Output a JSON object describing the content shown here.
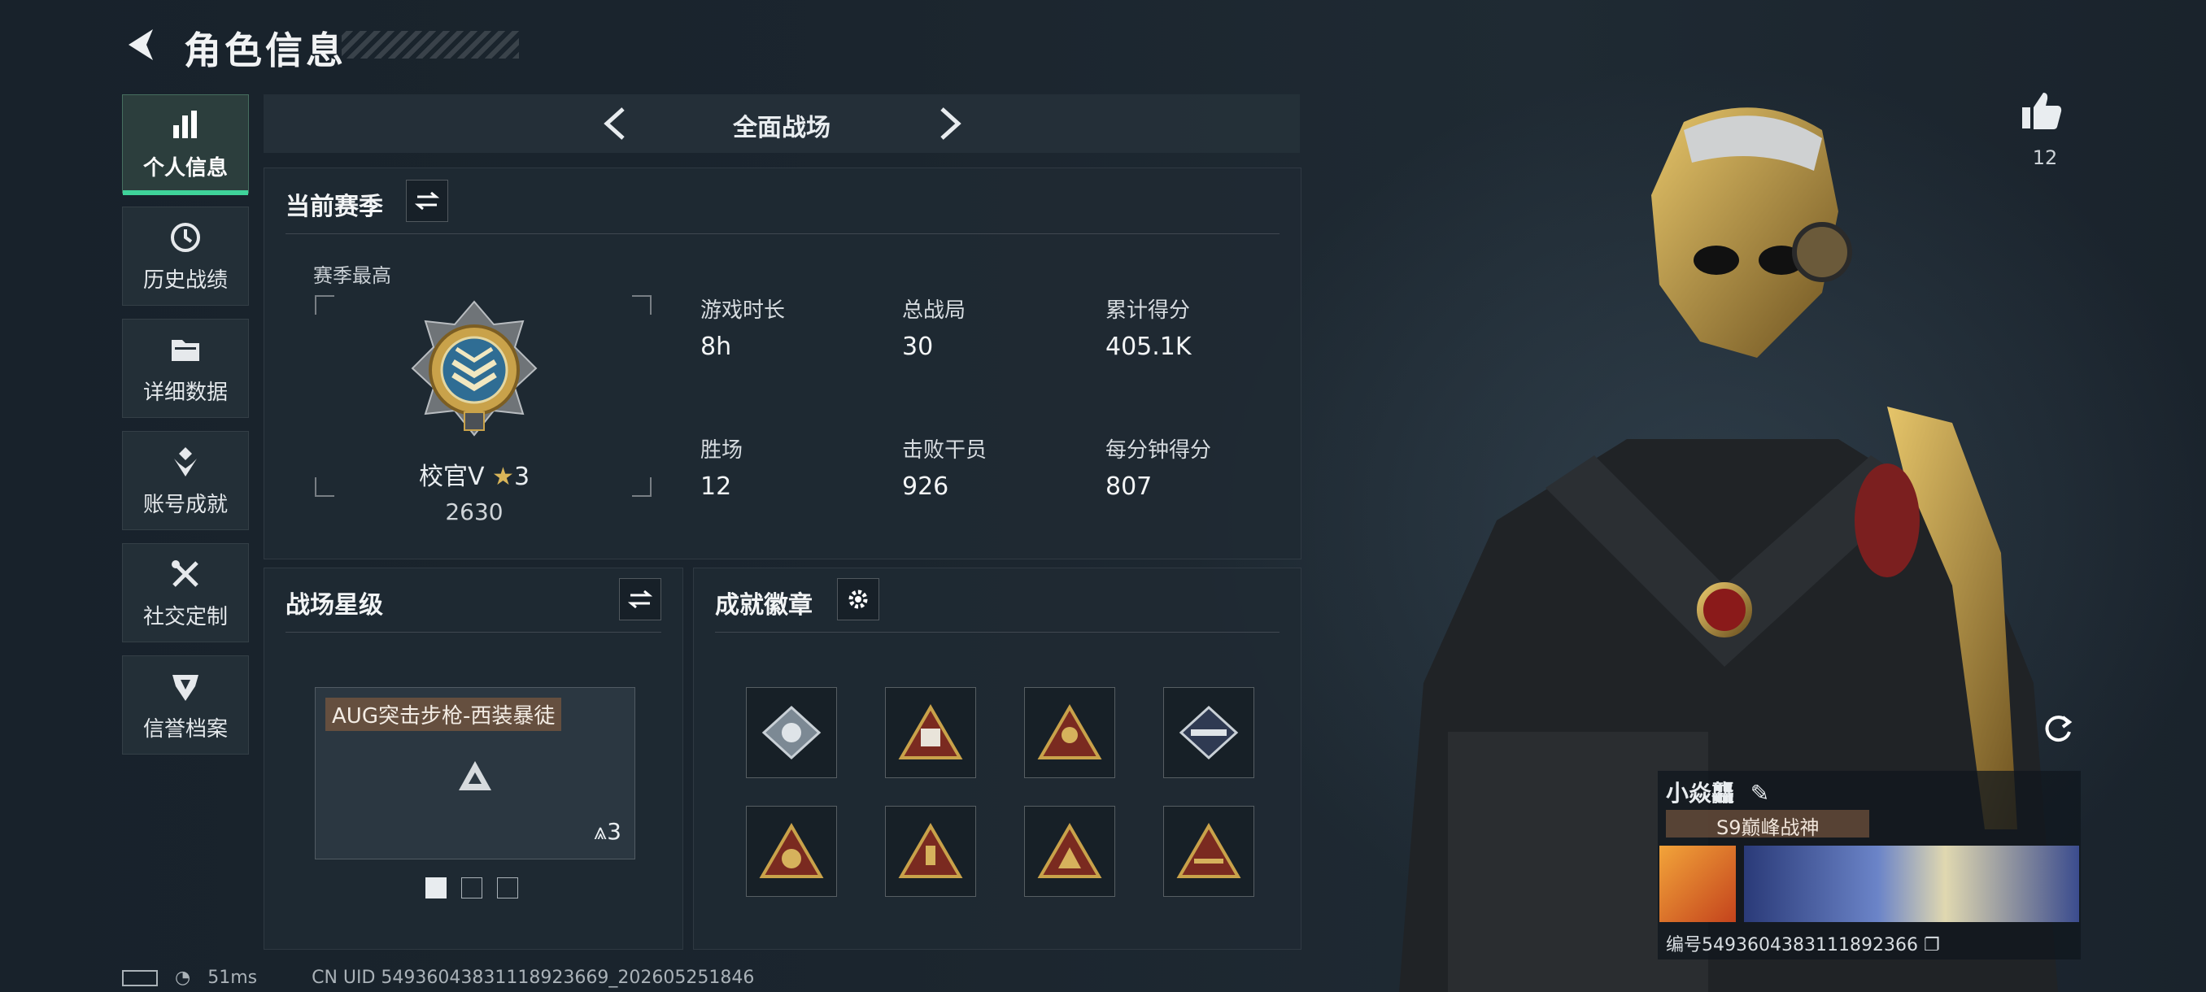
{
  "header": {
    "title": "角色信息"
  },
  "sidebar": {
    "items": [
      {
        "label": "个人信息",
        "icon": "bar-chart-icon",
        "active": true
      },
      {
        "label": "历史战绩",
        "icon": "history-clock-icon",
        "active": false
      },
      {
        "label": "详细数据",
        "icon": "folder-icon",
        "active": false
      },
      {
        "label": "账号成就",
        "icon": "achievement-badge-icon",
        "active": false
      },
      {
        "label": "社交定制",
        "icon": "wrench-screwdriver-icon",
        "active": false
      },
      {
        "label": "信誉档案",
        "icon": "shield-credit-icon",
        "active": false
      }
    ]
  },
  "mode": {
    "name": "全面战场"
  },
  "season": {
    "title": "当前赛季",
    "best_label": "赛季最高",
    "rank_name": "校官V",
    "rank_stars": "3",
    "rank_points": "2630",
    "stats": [
      {
        "label": "游戏时长",
        "value": "8h"
      },
      {
        "label": "总战局",
        "value": "30"
      },
      {
        "label": "累计得分",
        "value": "405.1K"
      },
      {
        "label": "胜场",
        "value": "12"
      },
      {
        "label": "击败干员",
        "value": "926"
      },
      {
        "label": "每分钟得分",
        "value": "807"
      }
    ]
  },
  "star_level": {
    "title": "战场星级",
    "weapon_name": "AUG突击步枪-西装暴徒",
    "stars": "3",
    "page_count": 3,
    "current_page": 1
  },
  "badges": {
    "title": "成就徽章",
    "count": 8
  },
  "profile": {
    "likes": "12",
    "nickname": "小焱龘",
    "title": "S9巅峰战神",
    "id_label": "编号",
    "id_value": "5493604383111892366"
  },
  "status_bar": {
    "ping": "51ms",
    "uid_text": "CN UID 54936043831118923669_202605251846"
  },
  "colors": {
    "accent": "#3fd39a",
    "gold": "#c9a24a",
    "badge_red": "#7a2a20"
  }
}
